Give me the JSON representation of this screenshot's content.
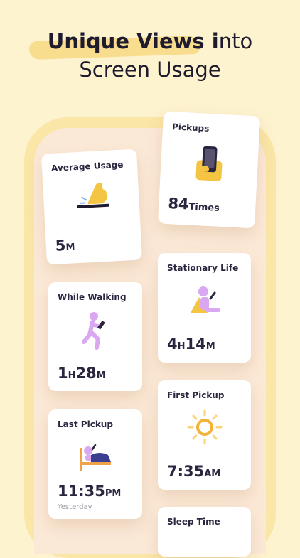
{
  "headline": {
    "line1_bold": "Unique Views i",
    "line1_regular": "nto",
    "line2": "Screen Usage"
  },
  "colors": {
    "background": "#fdf3cf",
    "phone_frame": "#fae6a6",
    "accent_yellow": "#f4c443",
    "accent_purple": "#d9a8f0",
    "text_dark": "#2c2540",
    "text_muted": "#9b9aa6"
  },
  "cards": {
    "average_usage": {
      "title": "Average Usage",
      "value": "5",
      "unit": "M",
      "icon": "finger-tap-icon"
    },
    "pickups": {
      "title": "Pickups",
      "value": "84",
      "unit": "Times",
      "icon": "hand-holding-phone-icon"
    },
    "while_walking": {
      "title": "While Walking",
      "hours": "1",
      "h_unit": "H",
      "minutes": "28",
      "m_unit": "M",
      "icon": "walking-person-icon"
    },
    "stationary_life": {
      "title": "Stationary Life",
      "hours": "4",
      "h_unit": "H",
      "minutes": "14",
      "m_unit": "M",
      "icon": "sitting-person-icon"
    },
    "last_pickup": {
      "title": "Last Pickup",
      "time": "11:35",
      "period": "PM",
      "subtitle": "Yesterday",
      "icon": "person-in-bed-icon"
    },
    "first_pickup": {
      "title": "First Pickup",
      "time": "7:35",
      "period": "AM",
      "icon": "sun-icon"
    },
    "sleep_time": {
      "title": "Sleep Time"
    }
  }
}
